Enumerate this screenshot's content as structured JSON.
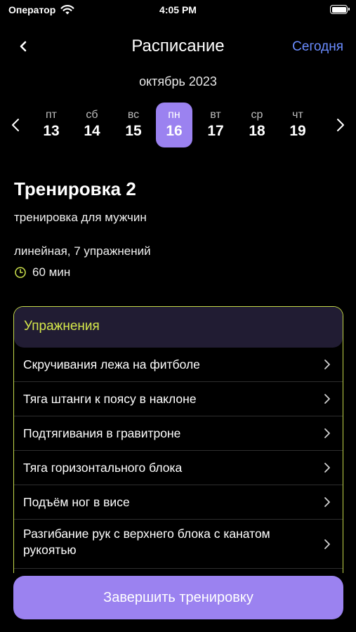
{
  "status_bar": {
    "carrier": "Оператор",
    "time": "4:05 PM"
  },
  "nav": {
    "title": "Расписание",
    "today": "Сегодня"
  },
  "calendar": {
    "month": "октябрь 2023",
    "days": [
      {
        "dow": "пт",
        "num": "13"
      },
      {
        "dow": "сб",
        "num": "14"
      },
      {
        "dow": "вс",
        "num": "15"
      },
      {
        "dow": "пн",
        "num": "16",
        "selected": true
      },
      {
        "dow": "вт",
        "num": "17"
      },
      {
        "dow": "ср",
        "num": "18"
      },
      {
        "dow": "чт",
        "num": "19"
      }
    ]
  },
  "workout": {
    "title": "Тренировка 2",
    "subtitle": "тренировка для мужчин",
    "meta": "линейная, 7 упражнений",
    "duration": "60 мин"
  },
  "exercises": {
    "header": "Упражнения",
    "items": [
      "Скручивания лежа на фитболе",
      "Тяга штанги к поясу в наклоне",
      "Подтягивания в гравитроне",
      "Тяга горизонтального блока",
      "Подъём ног в висе",
      "Разгибание рук с верхнего блока с канатом рукоятью"
    ]
  },
  "finish_button": "Завершить тренировку",
  "colors": {
    "accent_purple": "#9b82f0",
    "accent_lime": "#c5d94a",
    "link_blue": "#6a8cff",
    "background": "#000000"
  }
}
